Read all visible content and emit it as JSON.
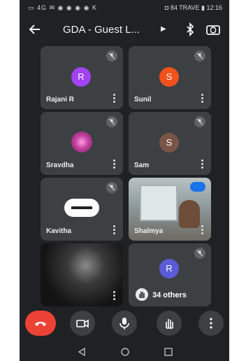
{
  "statusbar": {
    "left_indicators": "▭ 4G ✉ ◉ ◉ ◉ ◉ K",
    "right_text": "◘ 84 TRAVE ▮ 12:16"
  },
  "appbar": {
    "title": "GDA - Guest L...",
    "icons": [
      "back-arrow-icon",
      "bluetooth-icon",
      "switch-camera-icon"
    ]
  },
  "participants": [
    {
      "name": "Rajani R",
      "avatar_letter": "R",
      "avatar_color": "#a142f4",
      "type": "avatar"
    },
    {
      "name": "Sunil",
      "avatar_letter": "S",
      "avatar_color": "#f4511e",
      "type": "avatar"
    },
    {
      "name": "Sravdha",
      "avatar_letter": "",
      "avatar_color": "#c2409f",
      "type": "photo"
    },
    {
      "name": "Sam",
      "avatar_letter": "S",
      "avatar_color": "#795548",
      "type": "avatar"
    },
    {
      "name": "Kavitha",
      "avatar_letter": "",
      "avatar_color": "#ffffff",
      "type": "logo"
    },
    {
      "name": "Shalmya",
      "avatar_letter": "",
      "avatar_color": "",
      "type": "video"
    },
    {
      "name": "",
      "avatar_letter": "",
      "avatar_color": "",
      "type": "self-video"
    }
  ],
  "others_tile": {
    "avatar_letter": "R",
    "label": "34 others"
  },
  "controls": [
    "end-call",
    "camera",
    "microphone",
    "raise-hand",
    "more-options"
  ],
  "colors": {
    "background": "#202124",
    "tile": "#3c4043",
    "end_call": "#ea4335"
  }
}
